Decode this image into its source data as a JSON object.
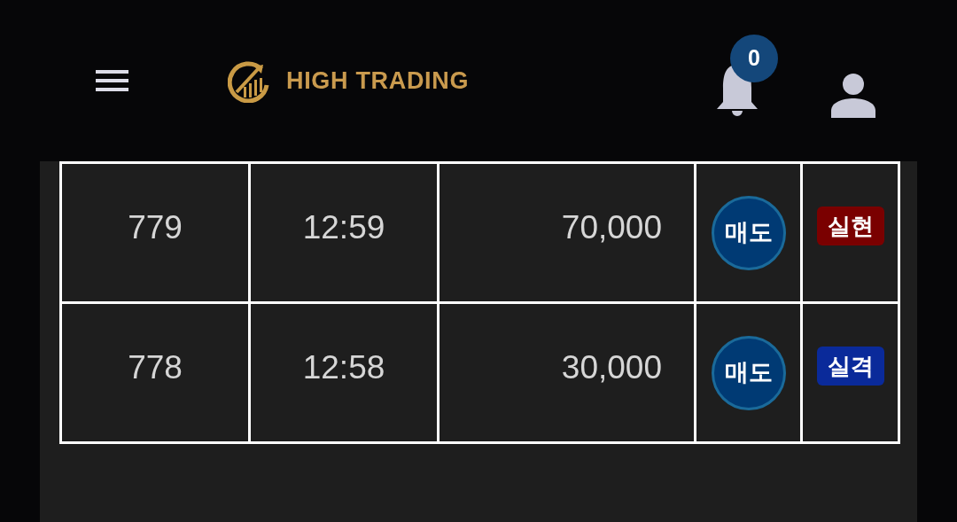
{
  "header": {
    "brand": "HIGH TRADING",
    "notification_count": "0"
  },
  "table": {
    "rows": [
      {
        "column_1": "779",
        "column_2": "12:59",
        "column_3": "70,000",
        "action": "매도",
        "result": {
          "label": "실현",
          "color": "#7a0000"
        }
      },
      {
        "column_1": "778",
        "column_2": "12:58",
        "column_3": "30,000",
        "action": "매도",
        "result": {
          "label": "실격",
          "color": "#0a2a9a"
        }
      }
    ]
  }
}
